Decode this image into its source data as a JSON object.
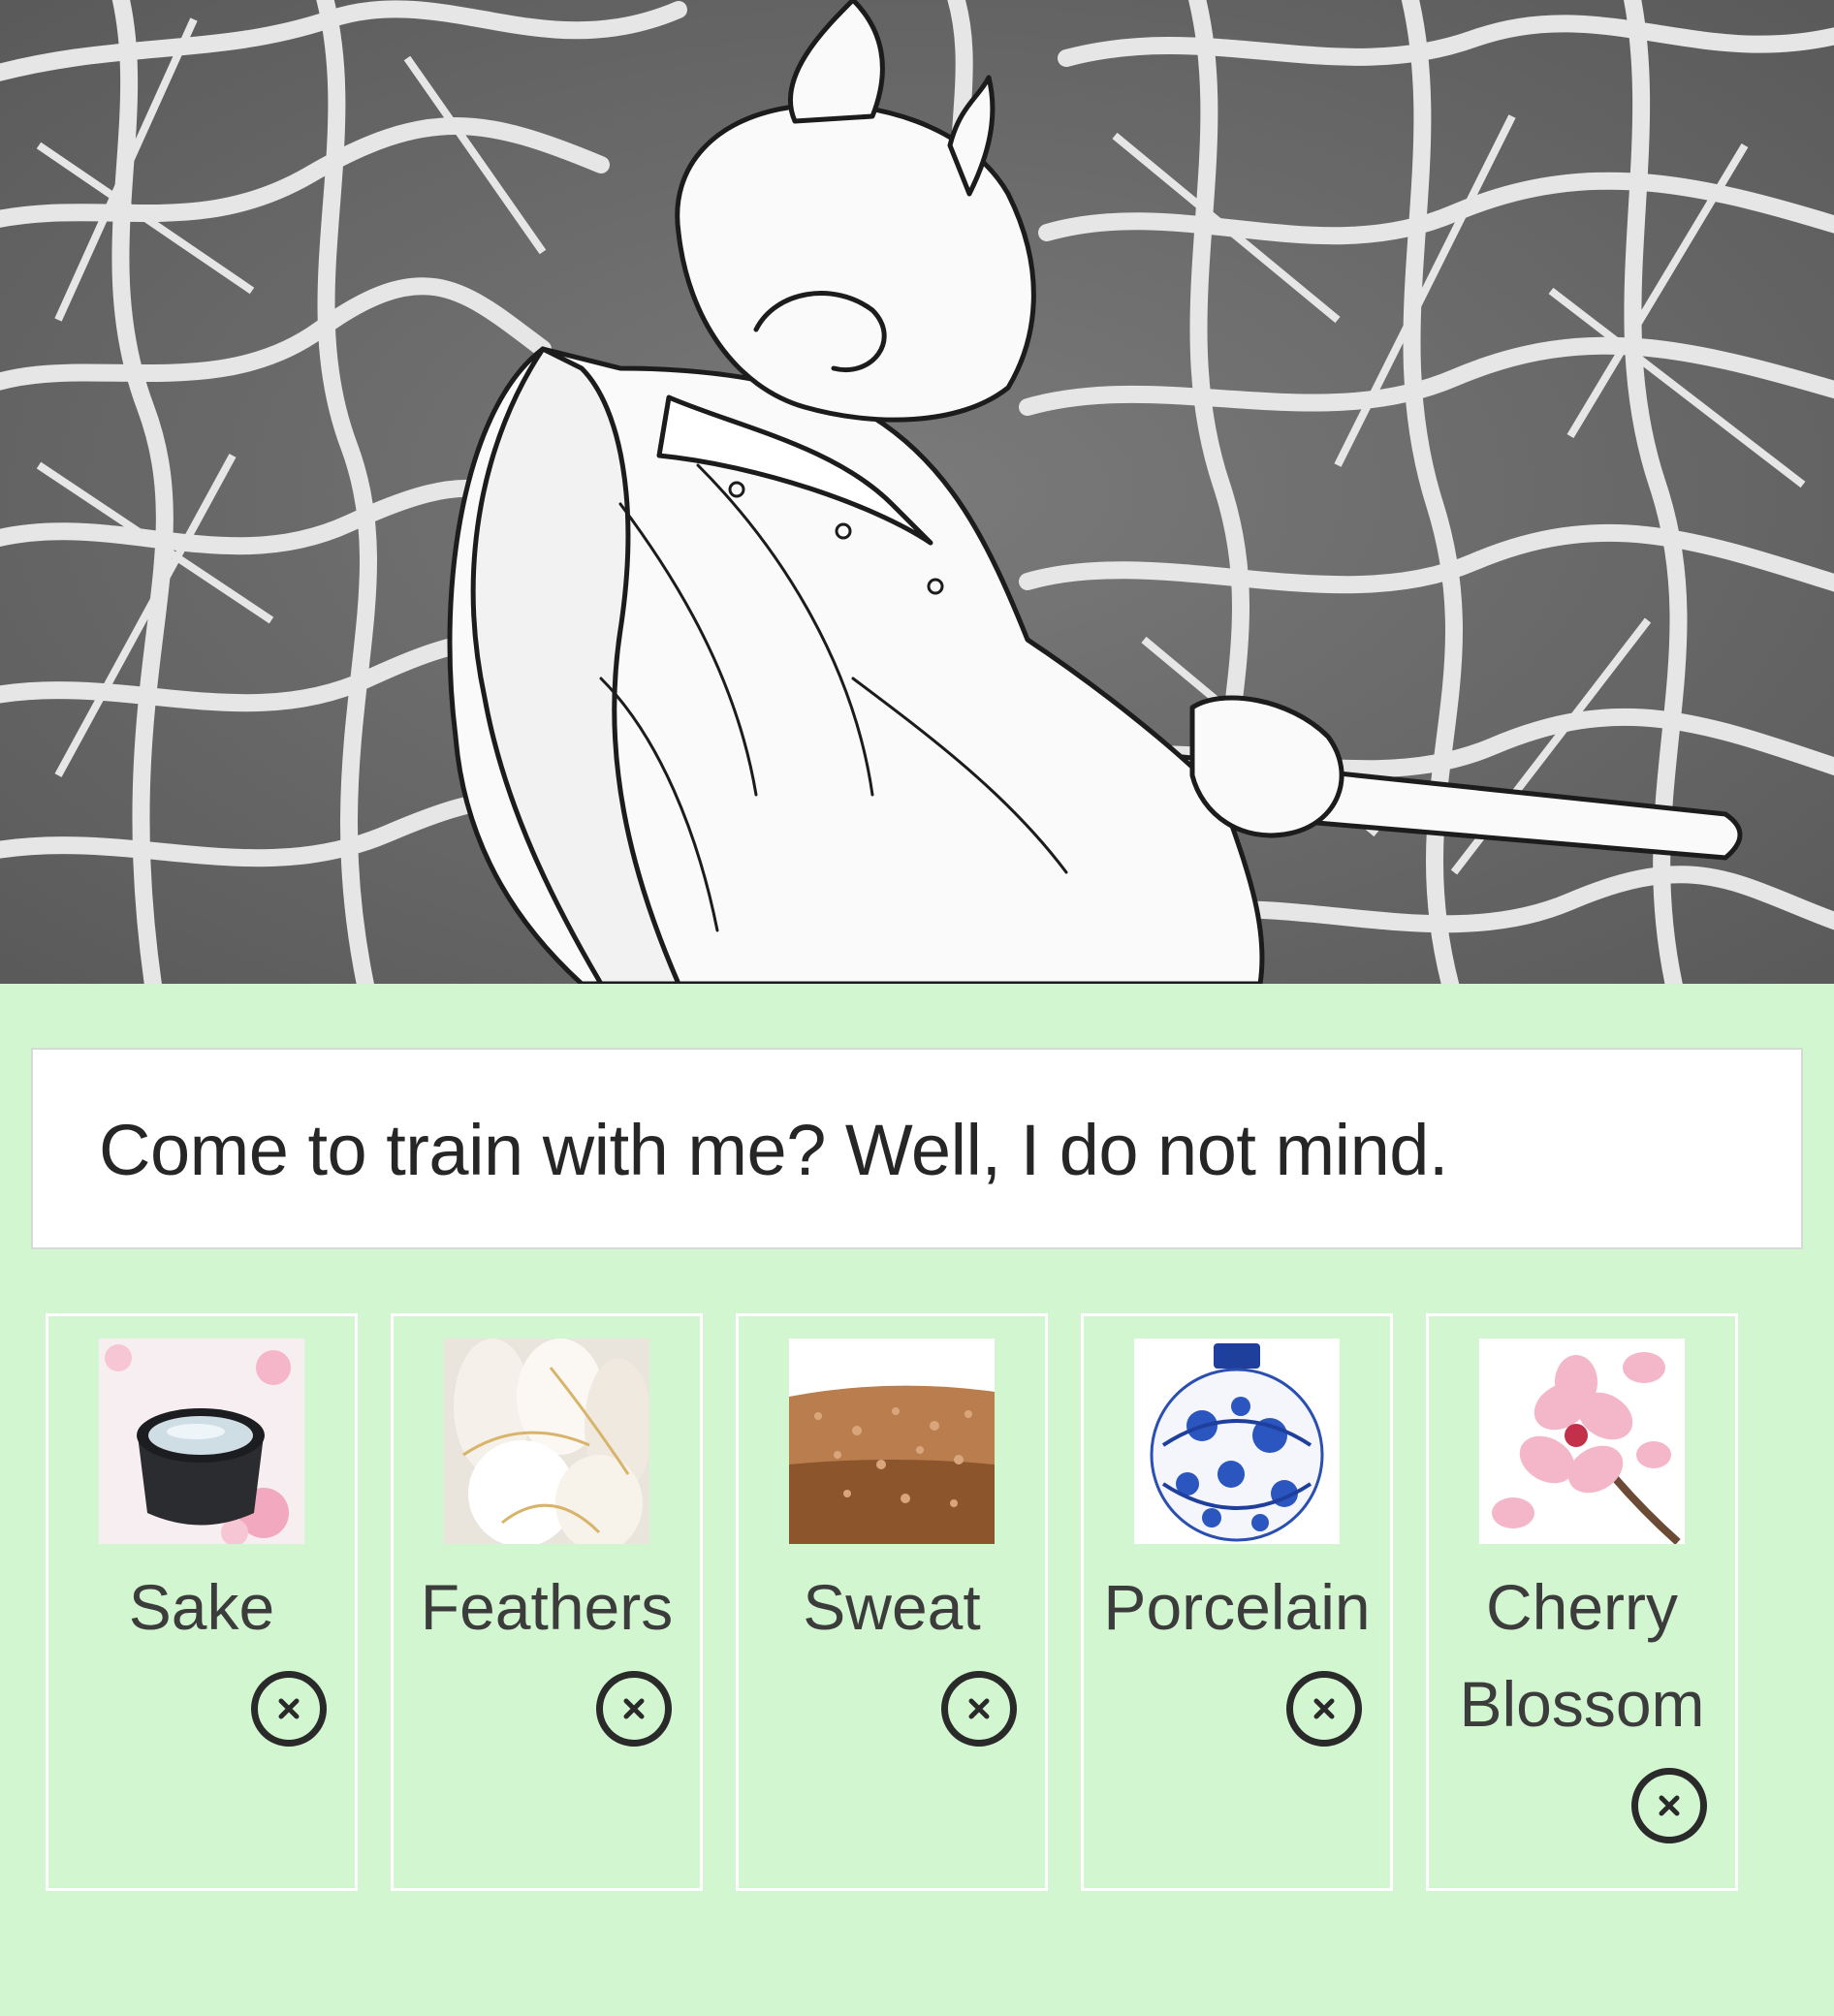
{
  "dialogue": {
    "text": "Come to train with me? Well, I do not mind."
  },
  "ingredients": [
    {
      "label": "Sake",
      "icon": "sake-cup-image"
    },
    {
      "label": "Feathers",
      "icon": "feathers-image"
    },
    {
      "label": "Sweat",
      "icon": "sweat-skin-image"
    },
    {
      "label": "Porcelain",
      "icon": "porcelain-vase-image"
    },
    {
      "label": "Cherry Blossom",
      "icon": "cherry-blossom-image"
    }
  ],
  "remove_icon": "close-circle-icon",
  "colors": {
    "panel_background": "#d2f7d0",
    "dialogue_background": "#ffffff"
  }
}
